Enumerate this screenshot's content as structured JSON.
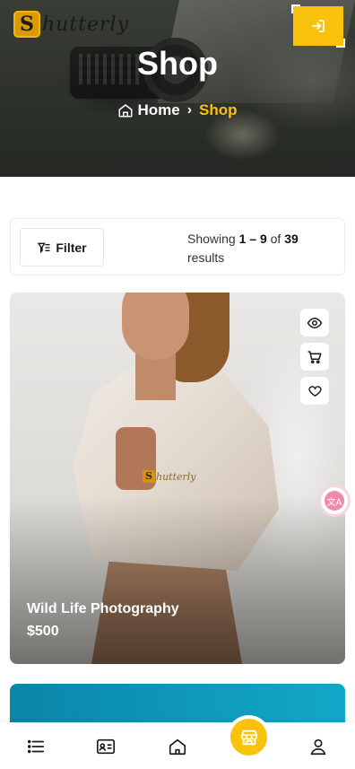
{
  "header": {
    "logo_initial": "S",
    "logo_text": "hutterly",
    "login_icon": "login-arrow-icon"
  },
  "hero": {
    "title": "Shop",
    "breadcrumb": {
      "home_label": "Home",
      "current_label": "Shop",
      "separator": "›"
    }
  },
  "toolbar": {
    "filter_label": "Filter",
    "results": {
      "prefix": "Showing",
      "range": "1 – 9",
      "of": "of",
      "total": "39",
      "suffix": "results"
    }
  },
  "products": [
    {
      "title": "Wild Life Photography",
      "price": "$500",
      "watermark_initial": "S",
      "watermark_text": "hutterly",
      "actions": [
        "quick-view-icon",
        "cart-icon",
        "heart-icon"
      ]
    }
  ],
  "floating": {
    "translate_label": "文A"
  },
  "bottom_nav": {
    "items": [
      "menu-icon",
      "profile-card-icon",
      "home-icon",
      "shop-icon",
      "user-icon"
    ],
    "active": "shop-icon"
  },
  "colors": {
    "accent": "#f9c20d",
    "text_dark": "#1a1a1a",
    "next_card": "#0a86a8"
  }
}
